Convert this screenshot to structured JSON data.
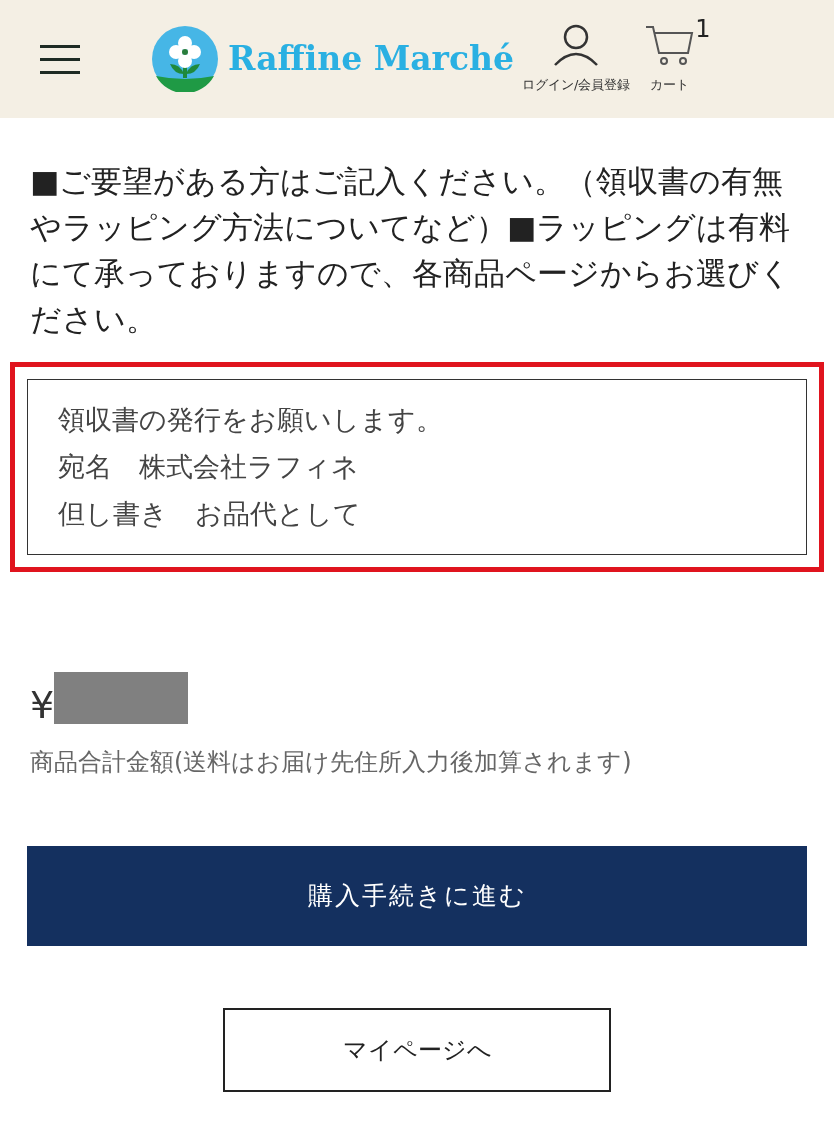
{
  "header": {
    "logo_text": "Raffine Marché",
    "login_label": "ログイン/会員登録",
    "cart_label": "カート",
    "cart_count": "1"
  },
  "request": {
    "instructions": "■ご要望がある方はご記入ください。（領収書の有無やラッピング方法についてなど）■ラッピングは有料にて承っておりますので、各商品ページからお選びください。",
    "lines": [
      "領収書の発行をお願いします。",
      "宛名　株式会社ラフィネ",
      "但し書き　お品代として"
    ],
    "highlighted": true
  },
  "total": {
    "currency": "¥",
    "note": "商品合計金額(送料はお届け先住所入力後加算されます)"
  },
  "buttons": {
    "checkout": "購入手続きに進む",
    "mypage": "マイページへ"
  }
}
